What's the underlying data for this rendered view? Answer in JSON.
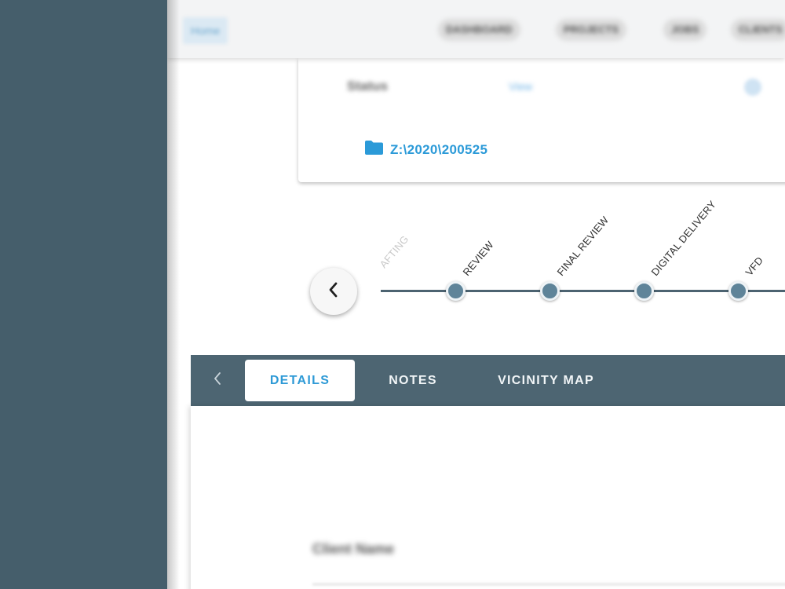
{
  "topbar": {
    "app_chip": "Home",
    "nav": [
      "DASHBOARD",
      "PROJECTS",
      "JOBS",
      "CLIENTS"
    ]
  },
  "card": {
    "field_label": "Status",
    "field_link": "View",
    "folder_icon": "folder-icon",
    "folder_path": "Z:\\2020\\200525"
  },
  "timeline": {
    "prev_icon": "chevron-left-icon",
    "steps": [
      {
        "label": "AFTING"
      },
      {
        "label": "REVIEW"
      },
      {
        "label": "FINAL REVIEW"
      },
      {
        "label": "DIGITAL DELIVERY"
      },
      {
        "label": "VFD"
      }
    ]
  },
  "tabs": {
    "back_icon": "chevron-left-icon",
    "items": [
      {
        "label": "DETAILS",
        "active": true
      },
      {
        "label": "NOTES",
        "active": false
      },
      {
        "label": "VICINITY MAP",
        "active": false
      }
    ]
  },
  "details": {
    "field_label": "Client Name"
  },
  "colors": {
    "sidebar": "#455e6b",
    "tabbar": "#4d6572",
    "accent": "#2e9ad6",
    "step_node": "#5f8499"
  }
}
